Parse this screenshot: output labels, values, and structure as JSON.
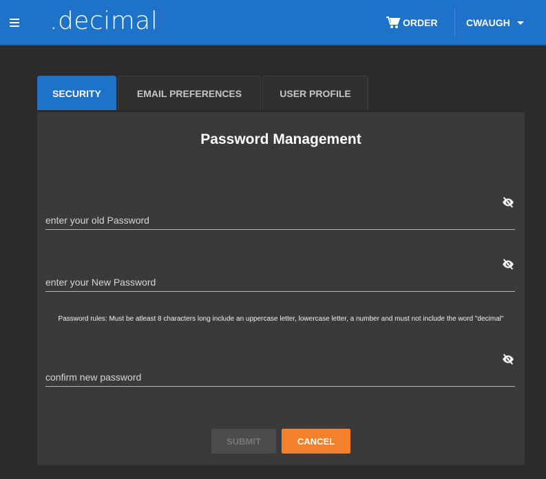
{
  "appbar": {
    "brand": ".decimal",
    "order_label": "ORDER",
    "user_label": "CWAUGH",
    "menu_icon": "hamburger-menu-icon",
    "cart_icon": "shopping-cart-icon",
    "user_caret_icon": "caret-down-icon",
    "color": "#1e73c8"
  },
  "tabs": [
    {
      "label": "SECURITY",
      "active": true
    },
    {
      "label": "EMAIL PREFERENCES",
      "active": false
    },
    {
      "label": "USER PROFILE",
      "active": false
    }
  ],
  "panel": {
    "title": "Password Management",
    "fields": {
      "old_password": {
        "placeholder": "enter your old Password",
        "value": "",
        "icon": "eye-off-icon"
      },
      "new_password": {
        "placeholder": "enter your New Password",
        "value": "",
        "icon": "eye-off-icon"
      },
      "confirm_password": {
        "placeholder": "confirm new password",
        "value": "",
        "icon": "eye-off-icon"
      }
    },
    "rules_text": "Password rules: Must be atleast 8 characters long include an uppercase letter, lowercase letter, a number and must not include the word \"decimal\"",
    "submit_label": "SUBMIT",
    "cancel_label": "CANCEL",
    "cancel_color": "#f5812a"
  }
}
